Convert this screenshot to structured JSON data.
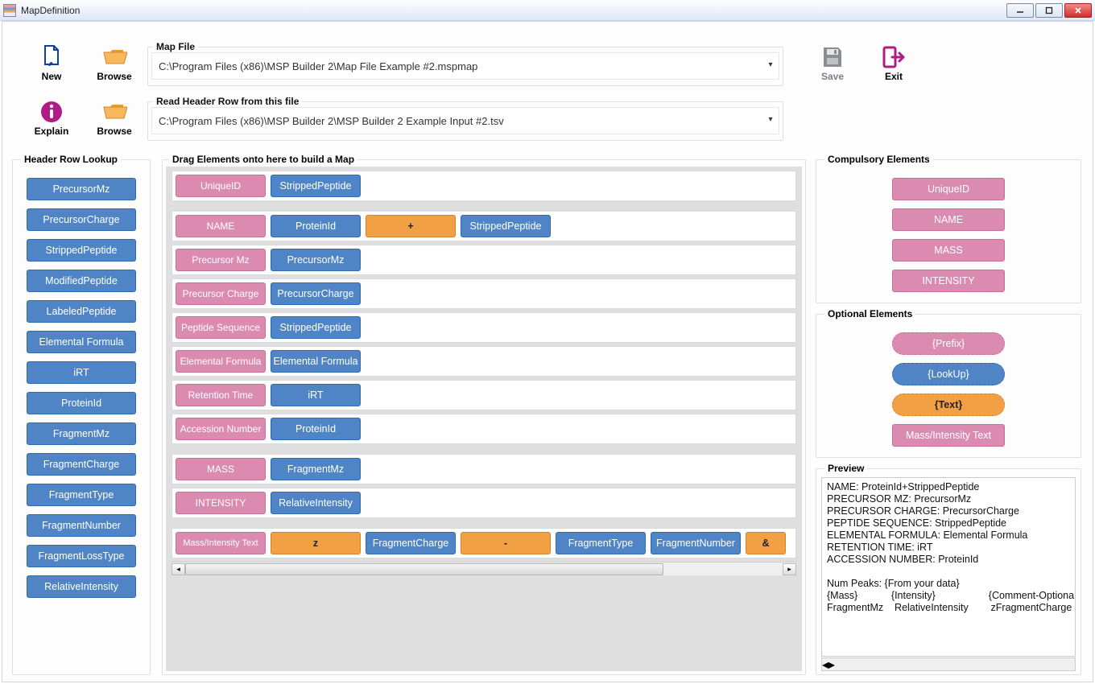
{
  "title": "MapDefinition",
  "toolbar": {
    "new": "New",
    "browse1": "Browse",
    "explain": "Explain",
    "browse2": "Browse",
    "save": "Save",
    "exit": "Exit"
  },
  "mapfile": {
    "legend": "Map File",
    "value": "C:\\Program Files (x86)\\MSP Builder 2\\Map File Example #2.mspmap"
  },
  "headerfile": {
    "legend": "Read Header Row from this file",
    "value": "C:\\Program Files (x86)\\MSP Builder 2\\MSP Builder 2 Example Input #2.tsv"
  },
  "lookup": {
    "legend": "Header Row Lookup",
    "items": [
      "PrecursorMz",
      "PrecursorCharge",
      "StrippedPeptide",
      "ModifiedPeptide",
      "LabeledPeptide",
      "Elemental Formula",
      "iRT",
      "ProteinId",
      "FragmentMz",
      "FragmentCharge",
      "FragmentType",
      "FragmentNumber",
      "FragmentLossType",
      "RelativeIntensity"
    ]
  },
  "build": {
    "legend": "Drag Elements onto here to build a Map",
    "rows": [
      {
        "cells": [
          {
            "t": "UniqueID",
            "c": "pink"
          },
          {
            "t": "StrippedPeptide",
            "c": "blue"
          }
        ]
      },
      {
        "cells": [
          {
            "t": "NAME",
            "c": "pink"
          },
          {
            "t": "ProteinId",
            "c": "blue"
          },
          {
            "t": "+",
            "c": "orange"
          },
          {
            "t": "StrippedPeptide",
            "c": "blue"
          }
        ]
      },
      {
        "cells": [
          {
            "t": "Precursor Mz",
            "c": "pink"
          },
          {
            "t": "PrecursorMz",
            "c": "blue"
          }
        ]
      },
      {
        "cells": [
          {
            "t": "Precursor Charge",
            "c": "pink"
          },
          {
            "t": "PrecursorCharge",
            "c": "blue"
          }
        ]
      },
      {
        "cells": [
          {
            "t": "Peptide Sequence",
            "c": "pink"
          },
          {
            "t": "StrippedPeptide",
            "c": "blue"
          }
        ]
      },
      {
        "cells": [
          {
            "t": "Elemental Formula",
            "c": "pink"
          },
          {
            "t": "Elemental Formula",
            "c": "blue"
          }
        ]
      },
      {
        "cells": [
          {
            "t": "Retention Time",
            "c": "pink"
          },
          {
            "t": "iRT",
            "c": "blue"
          }
        ]
      },
      {
        "cells": [
          {
            "t": "Accession Number",
            "c": "pink"
          },
          {
            "t": "ProteinId",
            "c": "blue"
          }
        ]
      },
      {
        "cells": [
          {
            "t": "MASS",
            "c": "pink"
          },
          {
            "t": "FragmentMz",
            "c": "blue"
          }
        ]
      },
      {
        "cells": [
          {
            "t": "INTENSITY",
            "c": "pink"
          },
          {
            "t": "RelativeIntensity",
            "c": "blue"
          }
        ]
      },
      {
        "cells": [
          {
            "t": "Mass/Intensity Text",
            "c": "pink",
            "small": true
          },
          {
            "t": "z",
            "c": "orange"
          },
          {
            "t": "FragmentCharge",
            "c": "blue"
          },
          {
            "t": "-",
            "c": "orange"
          },
          {
            "t": "FragmentType",
            "c": "blue"
          },
          {
            "t": "FragmentNumber",
            "c": "blue"
          },
          {
            "t": "&",
            "c": "orange",
            "cut": true
          }
        ]
      }
    ]
  },
  "compulsory": {
    "legend": "Compulsory Elements",
    "items": [
      "UniqueID",
      "NAME",
      "MASS",
      "INTENSITY"
    ]
  },
  "optional": {
    "legend": "Optional Elements",
    "items": [
      {
        "t": "{Prefix}",
        "c": "pink",
        "shape": "round dashed"
      },
      {
        "t": "{LookUp}",
        "c": "blue",
        "shape": "round dashed"
      },
      {
        "t": "{Text}",
        "c": "orange",
        "shape": "round dashed"
      },
      {
        "t": "Mass/Intensity Text",
        "c": "pink",
        "shape": ""
      }
    ]
  },
  "preview": {
    "legend": "Preview",
    "text": "NAME: ProteinId+StrippedPeptide\nPRECURSOR MZ: PrecursorMz\nPRECURSOR CHARGE: PrecursorCharge\nPEPTIDE SEQUENCE: StrippedPeptide\nELEMENTAL FORMULA: Elemental Formula\nRETENTION TIME: iRT\nACCESSION NUMBER: ProteinId\n\nNum Peaks: {From your data}\n{Mass}            {Intensity}                   {Comment-Optional}\nFragmentMz    RelativeIntensity        zFragmentCharge - Frag"
  }
}
